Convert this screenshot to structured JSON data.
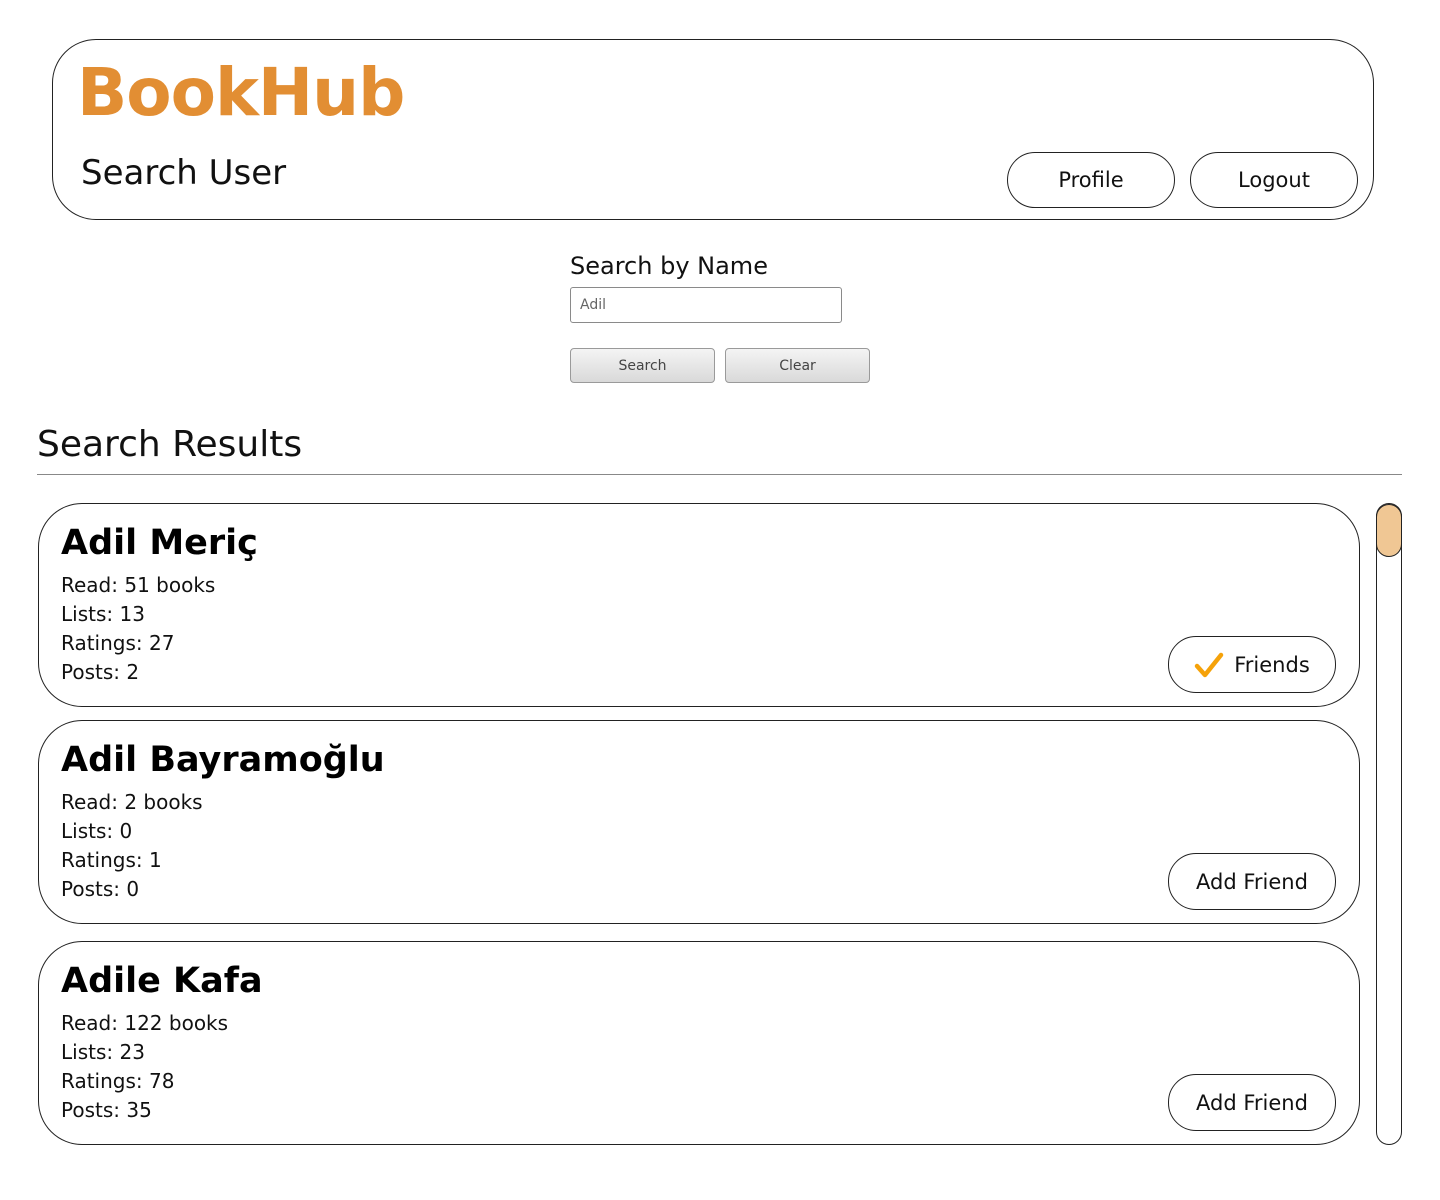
{
  "app": {
    "brand": "BookHub",
    "page_title": "Search User",
    "brand_color": "#e28e33"
  },
  "nav": {
    "profile_label": "Profile",
    "logout_label": "Logout"
  },
  "search": {
    "label": "Search by Name",
    "value": "Adil",
    "search_label": "Search",
    "clear_label": "Clear"
  },
  "results": {
    "title": "Search Results",
    "users": [
      {
        "name": "Adil Meriç",
        "read": "Read: 51 books",
        "lists": "Lists: 13",
        "ratings": "Ratings: 27",
        "posts": "Posts: 2",
        "action_label": "Friends",
        "action_icon": "check-icon",
        "check_color": "#f5a20a"
      },
      {
        "name": "Adil Bayramoğlu",
        "read": "Read: 2 books",
        "lists": "Lists: 0",
        "ratings": "Ratings: 1",
        "posts": "Posts: 0",
        "action_label": "Add Friend"
      },
      {
        "name": "Adile Kafa",
        "read": "Read: 122 books",
        "lists": "Lists: 23",
        "ratings": "Ratings: 78",
        "posts": "Posts: 35",
        "action_label": "Add Friend"
      }
    ]
  },
  "scrollbar": {
    "thumb_color": "#f0c794"
  }
}
